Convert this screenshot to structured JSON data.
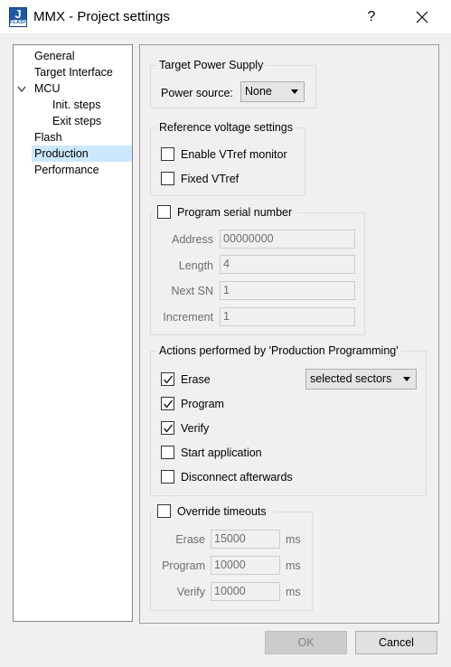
{
  "window": {
    "title": "MMX - Project settings",
    "help": "?",
    "icon_letter": "J",
    "icon_caption": "FLASH"
  },
  "tree": {
    "items": [
      "General",
      "Target Interface",
      "MCU",
      "Init. steps",
      "Exit steps",
      "Flash",
      "Production",
      "Performance"
    ],
    "selected": "Production"
  },
  "power": {
    "title": "Target Power Supply",
    "source_label": "Power source:",
    "source_value": "None"
  },
  "vref": {
    "title": "Reference voltage settings",
    "enable_label": "Enable VTref monitor",
    "fixed_label": "Fixed VTref"
  },
  "serial": {
    "title": "Program serial number",
    "address_label": "Address",
    "address_value": "00000000",
    "length_label": "Length",
    "length_value": "4",
    "next_label": "Next SN",
    "next_value": "1",
    "increment_label": "Increment",
    "increment_value": "1"
  },
  "actions": {
    "title": "Actions performed by 'Production Programming'",
    "erase_label": "Erase",
    "erase_checked": true,
    "erase_mode": "selected sectors",
    "program_label": "Program",
    "program_checked": true,
    "verify_label": "Verify",
    "verify_checked": true,
    "start_label": "Start application",
    "start_checked": false,
    "disconnect_label": "Disconnect afterwards",
    "disconnect_checked": false
  },
  "timeouts": {
    "title": "Override timeouts",
    "erase_label": "Erase",
    "erase_value": "15000",
    "program_label": "Program",
    "program_value": "10000",
    "verify_label": "Verify",
    "verify_value": "10000",
    "unit": "ms"
  },
  "buttons": {
    "ok": "OK",
    "cancel": "Cancel"
  }
}
